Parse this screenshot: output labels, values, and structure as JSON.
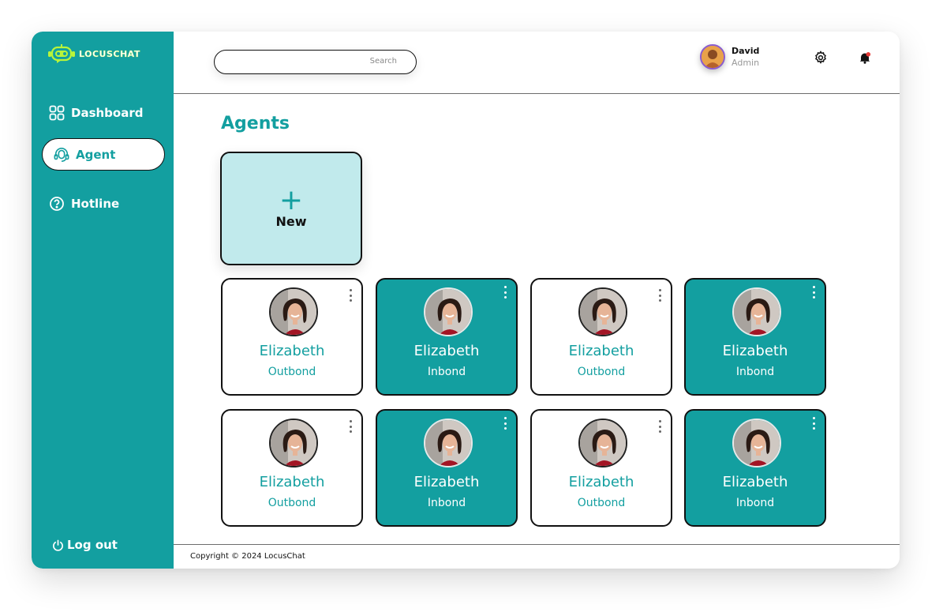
{
  "app": {
    "name": "LOCUSCHAT"
  },
  "sidebar": {
    "items": [
      {
        "label": "Dashboard",
        "icon": "grid-icon"
      },
      {
        "label": "Agent",
        "icon": "headset-icon",
        "active": true
      },
      {
        "label": "Hotline",
        "icon": "question-circle-icon"
      }
    ],
    "logout": {
      "label": "Log out",
      "icon": "power-icon"
    }
  },
  "header": {
    "search": {
      "placeholder": "Search"
    },
    "user": {
      "name": "David",
      "role": "Admin"
    },
    "icons": [
      "gear-icon",
      "bell-icon"
    ]
  },
  "main": {
    "title": "Agents",
    "new_card": {
      "label": "New",
      "icon": "plus-icon"
    },
    "agents": [
      {
        "name": "Elizabeth",
        "type": "Outbond",
        "style": "light"
      },
      {
        "name": "Elizabeth",
        "type": "Inbond",
        "style": "dark"
      },
      {
        "name": "Elizabeth",
        "type": "Outbond",
        "style": "light"
      },
      {
        "name": "Elizabeth",
        "type": "Inbond",
        "style": "dark"
      },
      {
        "name": "Elizabeth",
        "type": "Outbond",
        "style": "light"
      },
      {
        "name": "Elizabeth",
        "type": "Inbond",
        "style": "dark"
      },
      {
        "name": "Elizabeth",
        "type": "Outbond",
        "style": "light"
      },
      {
        "name": "Elizabeth",
        "type": "Inbond",
        "style": "dark"
      }
    ]
  },
  "footer": {
    "copyright": "Copyright © 2024  LocusChat"
  },
  "colors": {
    "primary": "#139fa0",
    "new_card": "#c1eaec",
    "logo_accent": "#b8f43a",
    "avatar_ring": "#8a5ccf"
  }
}
